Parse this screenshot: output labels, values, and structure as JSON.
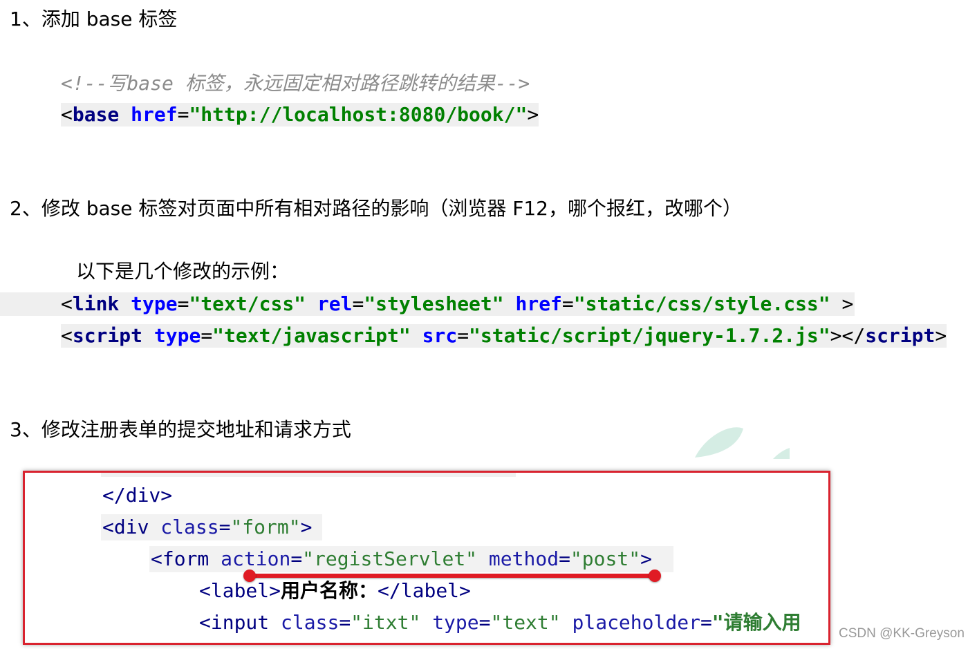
{
  "section1": {
    "heading": "1、添加 base 标签",
    "comment": "<!--写base 标签，永远固定相对路径跳转的结果-->",
    "code": {
      "open": "<",
      "tag": "base",
      "attr": "href",
      "eq": "=",
      "value": "\"http://localhost:8080/book/\"",
      "close": ">"
    }
  },
  "section2": {
    "heading": "2、修改 base 标签对页面中所有相对路径的影响（浏览器 F12，哪个报红，改哪个）",
    "intro": "以下是几个修改的示例：",
    "link_line": {
      "open": "<",
      "tag": "link",
      "attr1": "type",
      "val1": "\"text/css\"",
      "attr2": "rel",
      "val2": "\"stylesheet\"",
      "attr3": "href",
      "val3": "\"static/css/style.css\"",
      "close": " >"
    },
    "script_line": {
      "open": "<",
      "tag": "script",
      "attr1": "type",
      "val1": "\"text/javascript\"",
      "attr2": "src",
      "val2": "\"static/script/jquery-1.7.2.js\"",
      "close": "></",
      "endtag": "script",
      "end": ">"
    }
  },
  "section3": {
    "heading": "3、修改注册表单的提交地址和请求方式",
    "screenshot": {
      "line1": {
        "open": "</",
        "tag": "div",
        "close": ">"
      },
      "line2": {
        "open": "<",
        "tag": "div",
        "attr": "class",
        "val": "\"form\"",
        "close": ">"
      },
      "line3": {
        "open": "<",
        "tag": "form",
        "attr1": "action",
        "val1": "\"registServlet\"",
        "attr2": "method",
        "val2": "\"post\"",
        "close": ">"
      },
      "line4": {
        "open": "<",
        "tag": "label",
        "close": ">",
        "text": "用户名称：",
        "endopen": "</",
        "endtag": "label",
        "end": ">"
      },
      "line5": {
        "open": "<",
        "tag": "input",
        "attr1": "class",
        "val1": "\"itxt\"",
        "attr2": "type",
        "val2": "\"text\"",
        "attr3": "placeholder",
        "val3": "\"请输入用"
      }
    }
  },
  "watermark": "CSDN @KK-Greyson",
  "colors": {
    "tag": "#000080",
    "attr": "#0000ff",
    "value": "#008000",
    "comment": "#8c8c8c",
    "frame": "#d9232f",
    "mark": "#e01b24"
  }
}
